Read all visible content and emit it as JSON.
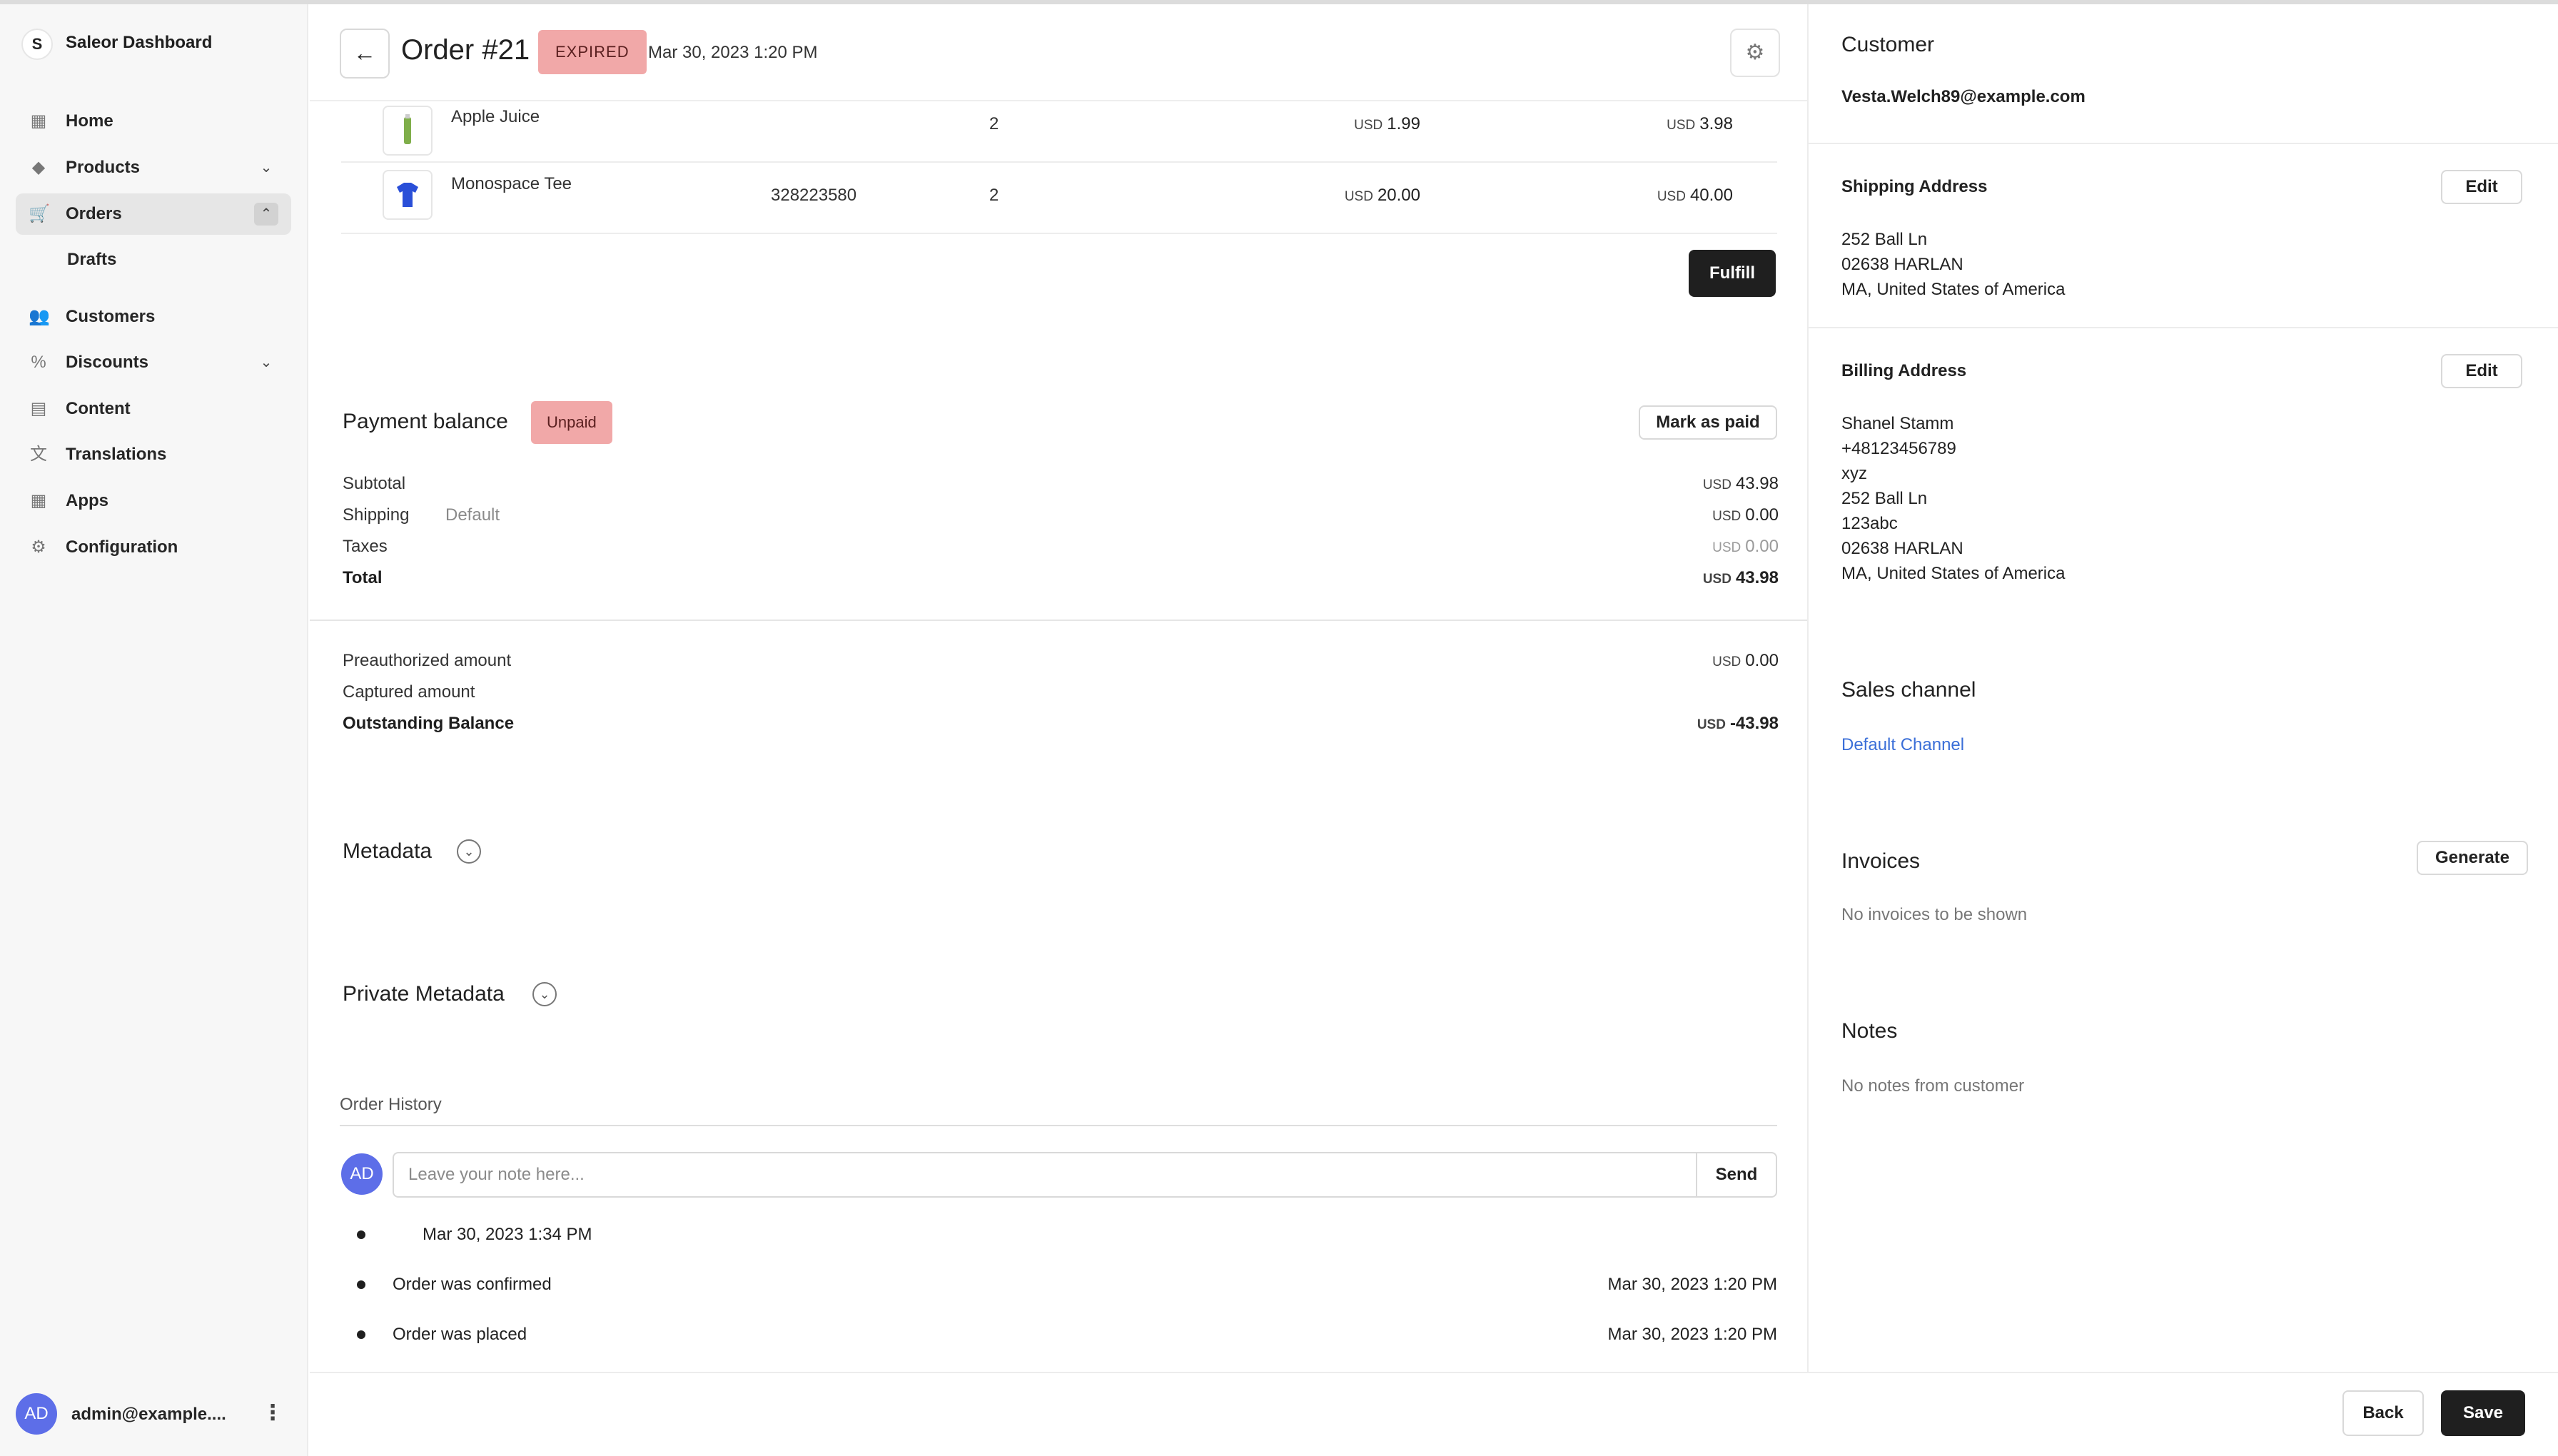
{
  "sidebar": {
    "brand": {
      "logo": "S",
      "name": "Saleor Dashboard"
    },
    "items": [
      {
        "label": "Home",
        "icon": "home-icon",
        "glyph": "▦"
      },
      {
        "label": "Products",
        "icon": "tag-icon",
        "glyph": "◆"
      },
      {
        "label": "Orders",
        "icon": "cart-icon",
        "glyph": "🛒"
      },
      {
        "label": "Drafts"
      },
      {
        "label": "Customers",
        "icon": "customers-icon",
        "glyph": "👥"
      },
      {
        "label": "Discounts",
        "icon": "discount-icon",
        "glyph": "%"
      },
      {
        "label": "Content",
        "icon": "content-icon",
        "glyph": "▤"
      },
      {
        "label": "Translations",
        "icon": "translations-icon",
        "glyph": "文"
      },
      {
        "label": "Apps",
        "icon": "apps-icon",
        "glyph": "▦"
      },
      {
        "label": "Configuration",
        "icon": "gear-icon",
        "glyph": "⚙"
      }
    ],
    "user": {
      "initials": "AD",
      "email": "admin@example...."
    }
  },
  "header": {
    "back_glyph": "←",
    "title": "Order #21",
    "status": "EXPIRED",
    "date": "Mar 30, 2023 1:20 PM",
    "settings_glyph": "⚙"
  },
  "lines": [
    {
      "name": "Apple Juice",
      "sku": "",
      "qty": "2",
      "price_cur": "USD",
      "price": "1.99",
      "total_cur": "USD",
      "total": "3.98"
    },
    {
      "name": "Monospace Tee",
      "sku": "328223580",
      "qty": "2",
      "price_cur": "USD",
      "price": "20.00",
      "total_cur": "USD",
      "total": "40.00"
    }
  ],
  "fulfill_label": "Fulfill",
  "payment": {
    "title": "Payment balance",
    "status": "Unpaid",
    "mark_paid_label": "Mark as paid",
    "subtotal_label": "Subtotal",
    "subtotal_cur": "USD",
    "subtotal": "43.98",
    "shipping_label": "Shipping",
    "shipping_method": "Default",
    "shipping_cur": "USD",
    "shipping": "0.00",
    "taxes_label": "Taxes",
    "taxes_cur": "USD",
    "taxes": "0.00",
    "total_label": "Total",
    "total_cur": "USD",
    "total": "43.98",
    "preauth_label": "Preauthorized amount",
    "preauth_cur": "USD",
    "preauth": "0.00",
    "captured_label": "Captured amount",
    "outstanding_label": "Outstanding Balance",
    "outstanding_cur": "USD",
    "outstanding": "-43.98"
  },
  "metadata": {
    "title": "Metadata",
    "private_title": "Private Metadata",
    "expand_glyph": "⌄"
  },
  "history": {
    "title": "Order History",
    "avatar": "AD",
    "note_placeholder": "Leave your note here...",
    "send_label": "Send",
    "events": [
      {
        "text": "Mar 30, 2023 1:34 PM",
        "date": ""
      },
      {
        "text": "Order was confirmed",
        "date": "Mar 30, 2023 1:20 PM"
      },
      {
        "text": "Order was placed",
        "date": "Mar 30, 2023 1:20 PM"
      }
    ]
  },
  "customer": {
    "title": "Customer",
    "email": "Vesta.Welch89@example.com",
    "shipping_title": "Shipping Address",
    "shipping_lines": [
      "252 Ball Ln",
      "02638 HARLAN",
      "MA, United States of America"
    ],
    "billing_title": "Billing Address",
    "billing_lines": [
      "Shanel Stamm",
      "+48123456789",
      "xyz",
      "252 Ball Ln",
      "123abc",
      "02638 HARLAN",
      "MA, United States of America"
    ],
    "edit_label": "Edit"
  },
  "sales_channel": {
    "title": "Sales channel",
    "value": "Default Channel"
  },
  "invoices": {
    "title": "Invoices",
    "generate_label": "Generate",
    "empty": "No invoices to be shown"
  },
  "notes": {
    "title": "Notes",
    "empty": "No notes from customer"
  },
  "footer": {
    "back_label": "Back",
    "save_label": "Save"
  },
  "colors": {
    "accent": "#5d6ee8",
    "badge": "#f1a8a8",
    "dark_button": "#1f1f1f",
    "link": "#3b6fd8"
  }
}
